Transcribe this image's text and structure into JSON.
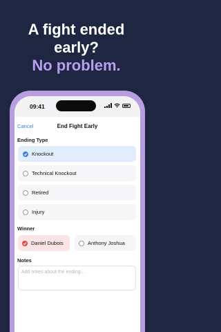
{
  "headline": {
    "line1": "A fight ended",
    "line2": "early?",
    "line3": "No problem."
  },
  "status_bar": {
    "time": "09:41"
  },
  "nav": {
    "cancel_label": "Cancel",
    "title": "End Fight Early"
  },
  "ending_type": {
    "label": "Ending Type",
    "options": [
      {
        "label": "Knockout",
        "selected": true
      },
      {
        "label": "Technical Knockout",
        "selected": false
      },
      {
        "label": "Retired",
        "selected": false
      },
      {
        "label": "Injury",
        "selected": false
      }
    ]
  },
  "winner": {
    "label": "Winner",
    "options": [
      {
        "label": "Daniel Dubois",
        "selected": true
      },
      {
        "label": "Anthony Joshua",
        "selected": false
      }
    ]
  },
  "notes": {
    "label": "Notes",
    "placeholder": "Add notes about the ending...",
    "value": ""
  },
  "colors": {
    "background": "#1e2641",
    "accent_purple": "#b69ff0",
    "link_blue": "#3b7ce0",
    "winner_red": "#e04545"
  }
}
